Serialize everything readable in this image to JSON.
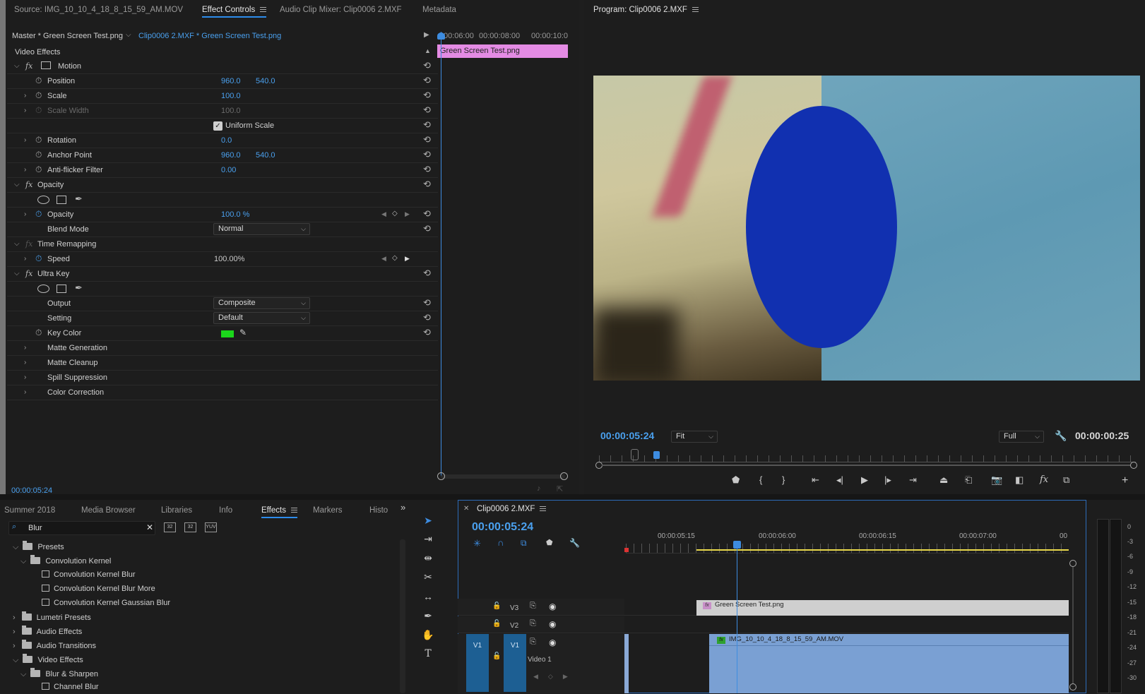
{
  "top_tabs": {
    "source": "Source: IMG_10_10_4_18_8_15_59_AM.MOV",
    "effect_controls": "Effect Controls",
    "audio_mixer": "Audio Clip Mixer: Clip0006 2.MXF",
    "metadata": "Metadata",
    "program": "Program: Clip0006 2.MXF"
  },
  "effect_controls": {
    "master": "Master * Green Screen Test.png",
    "clip": "Clip0006 2.MXF * Green Screen Test.png",
    "section": "Video Effects",
    "mini_times": [
      "00:06:00",
      "00:00:08:00",
      "00:00:10:0"
    ],
    "clip_bar": "Green Screen Test.png",
    "motion": "Motion",
    "position_label": "Position",
    "position_x": "960.0",
    "position_y": "540.0",
    "scale_label": "Scale",
    "scale_val": "100.0",
    "scale_width_label": "Scale Width",
    "scale_width_val": "100.0",
    "uniform_scale": "Uniform Scale",
    "rotation_label": "Rotation",
    "rotation_val": "0.0",
    "anchor_label": "Anchor Point",
    "anchor_x": "960.0",
    "anchor_y": "540.0",
    "antiflicker_label": "Anti-flicker Filter",
    "antiflicker_val": "0.00",
    "opacity_fx": "Opacity",
    "opacity_label": "Opacity",
    "opacity_val": "100.0 %",
    "blend_label": "Blend Mode",
    "blend_val": "Normal",
    "time_remap": "Time Remapping",
    "speed_label": "Speed",
    "speed_val": "100.00%",
    "ultra_key": "Ultra Key",
    "output_label": "Output",
    "output_val": "Composite",
    "setting_label": "Setting",
    "setting_val": "Default",
    "keycolor_label": "Key Color",
    "keycolor": "#1bd61b",
    "matte_gen": "Matte Generation",
    "matte_clean": "Matte Cleanup",
    "spill": "Spill Suppression",
    "color_corr": "Color Correction",
    "timecode": "00:00:05:24"
  },
  "program": {
    "timecode": "00:00:05:24",
    "fit": "Fit",
    "full": "Full",
    "duration": "00:00:00:25"
  },
  "bottom_tabs": {
    "summer": "Summer 2018",
    "media": "Media Browser",
    "libraries": "Libraries",
    "info": "Info",
    "effects": "Effects",
    "markers": "Markers",
    "history": "Histo"
  },
  "effects_panel": {
    "search": "Blur",
    "icons": [
      "32",
      "32",
      "YUV"
    ],
    "items": [
      {
        "label": "Presets"
      },
      {
        "label": "Convolution Kernel"
      },
      {
        "label": "Convolution Kernel Blur"
      },
      {
        "label": "Convolution Kernel Blur More"
      },
      {
        "label": "Convolution Kernel Gaussian Blur"
      },
      {
        "label": "Lumetri Presets"
      },
      {
        "label": "Audio Effects"
      },
      {
        "label": "Audio Transitions"
      },
      {
        "label": "Video Effects"
      },
      {
        "label": "Blur & Sharpen"
      },
      {
        "label": "Channel Blur"
      }
    ]
  },
  "timeline": {
    "sequence": "Clip0006 2.MXF",
    "timecode": "00:00:05:24",
    "ruler": [
      "00:00:05:15",
      "00:00:06:00",
      "00:00:06:15",
      "00:00:07:00",
      "00"
    ],
    "v3": "V3",
    "v2": "V2",
    "v1": "V1",
    "v1_src": "V1",
    "video1": "Video 1",
    "clip_v3": "Green Screen Test.png",
    "clip_v1": "IMG_10_10_4_18_8_15_59_AM.MOV"
  },
  "meter": [
    "0",
    "-3",
    "-6",
    "-9",
    "-12",
    "-15",
    "-18",
    "-21",
    "-24",
    "-27",
    "-30"
  ]
}
